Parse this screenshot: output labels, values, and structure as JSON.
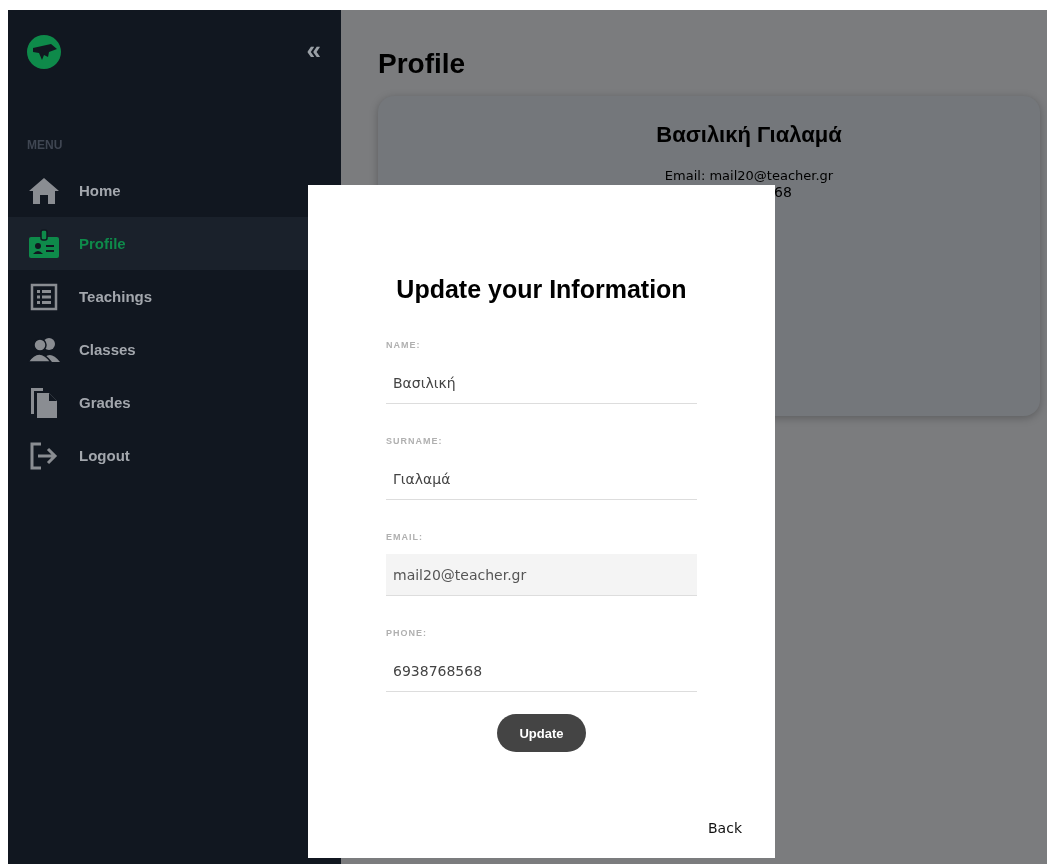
{
  "sidebar": {
    "collapse_glyph": "«",
    "menu_label": "MENU",
    "items": [
      {
        "label": "Home",
        "kind": "home",
        "selected": false
      },
      {
        "label": "Profile",
        "kind": "badge",
        "selected": true
      },
      {
        "label": "Teachings",
        "kind": "list",
        "selected": false
      },
      {
        "label": "Classes",
        "kind": "people",
        "selected": false
      },
      {
        "label": "Grades",
        "kind": "files",
        "selected": false
      },
      {
        "label": "Logout",
        "kind": "logout",
        "selected": false
      }
    ]
  },
  "page": {
    "title": "Profile",
    "card": {
      "name": "Βασιλική Γιαλαμά",
      "email_line": "Email: mail20@teacher.gr",
      "phone_fragment": "68"
    }
  },
  "dialog": {
    "title": "Update your Information",
    "fields": [
      {
        "label": "NAME:",
        "value": "Βασιλική",
        "disabled": false
      },
      {
        "label": "SURNAME:",
        "value": "Γιαλαμά",
        "disabled": false
      },
      {
        "label": "EMAIL:",
        "value": "mail20@teacher.gr",
        "disabled": true
      },
      {
        "label": "PHONE:",
        "value": "6938768568",
        "disabled": false
      }
    ],
    "submit": "Update",
    "back": "Back"
  }
}
